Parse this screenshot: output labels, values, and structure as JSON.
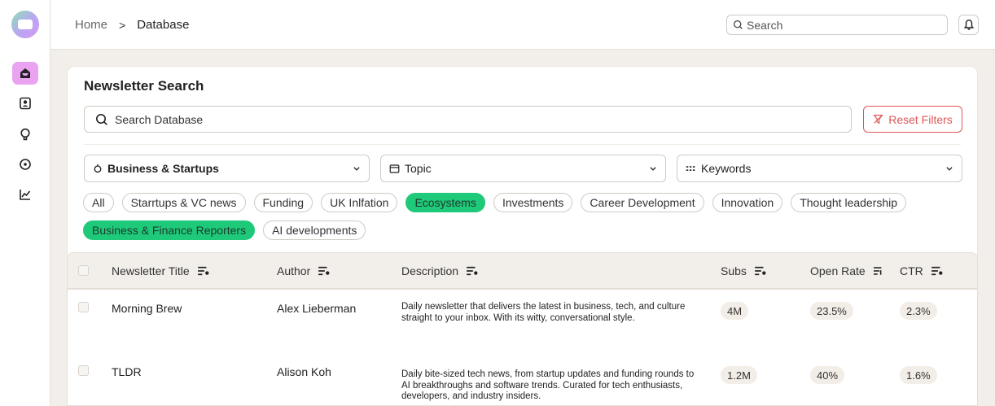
{
  "breadcrumb": {
    "home": "Home",
    "separator": ">",
    "current": "Database"
  },
  "top_search": {
    "placeholder": "Search"
  },
  "panel": {
    "title": "Newsletter Search",
    "search_placeholder": "Search Database",
    "reset_label": "Reset Filters"
  },
  "filters": {
    "category": "Business & Startups",
    "topic": "Topic",
    "keywords": "Keywords"
  },
  "chips_row1": [
    "All",
    "Starrtups & VC news",
    "Funding",
    "UK Inlfation",
    "Ecosystems",
    "Investments",
    "Career Development",
    "Innovation",
    "Thought leadership"
  ],
  "chips_row2": [
    "Business & Finance Reporters",
    "AI developments"
  ],
  "active_chips": [
    "Ecosystems",
    "Business & Finance Reporters"
  ],
  "table": {
    "columns": {
      "title": "Newsletter Title",
      "author": "Author",
      "description": "Description",
      "subs": "Subs",
      "open_rate": "Open Rate",
      "ctr": "CTR"
    },
    "rows": [
      {
        "title": "Morning Brew",
        "author": "Alex Lieberman",
        "description": "Daily newsletter that delivers the latest in business, tech, and culture straight to your inbox. With its witty, conversational style.",
        "subs": "4M",
        "open_rate": "23.5%",
        "ctr": "2.3%"
      },
      {
        "title": "TLDR",
        "author": "Alison Koh",
        "description": "Daily bite-sized tech news, from startup updates and funding rounds to AI breakthroughs and software trends. Curated for tech enthusiasts, developers, and industry insiders.",
        "subs": "1.2M",
        "open_rate": "40%",
        "ctr": "1.6%"
      }
    ]
  },
  "sidebar": {
    "icons": [
      "inbox-icon",
      "contacts-icon",
      "idea-icon",
      "explore-icon",
      "analytics-icon"
    ]
  },
  "colors": {
    "accent_green": "#1fc97a",
    "nav_active": "#e9a3f0",
    "danger": "#e05656",
    "background": "#f2efea"
  }
}
